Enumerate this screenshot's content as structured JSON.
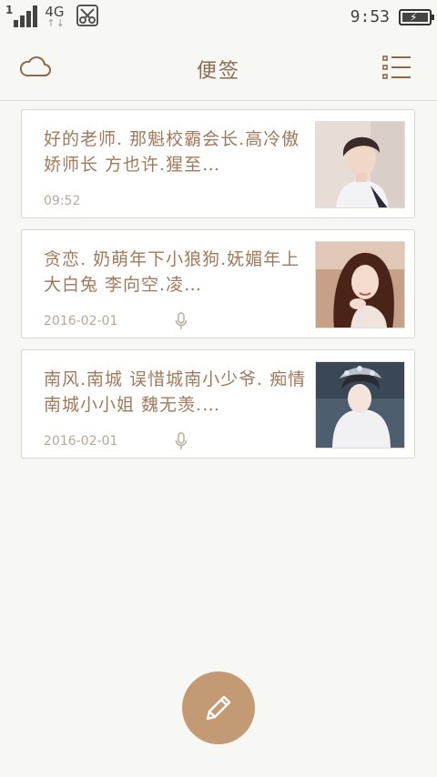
{
  "status_bar": {
    "signal_level": "1",
    "network": "4G",
    "network_arrows": "↑↓",
    "time": "9:53",
    "icons": [
      "signal-icon",
      "network-4g-icon",
      "no-sim-icon",
      "battery-charging-icon"
    ]
  },
  "app_bar": {
    "title": "便签",
    "left_icon": "cloud-icon",
    "right_icon": "list-view-icon"
  },
  "notes": [
    {
      "text": "好的老师. 那魁校霸会长.高冷傲娇师长 方也许.猩至…",
      "date": "09:52",
      "has_audio": false,
      "thumb_icon": "photo-portrait-man-icon"
    },
    {
      "text": "贪恋. 奶萌年下小狼狗.妩媚年上大白兔 李向空.凌…",
      "date": "2016-02-01",
      "has_audio": true,
      "thumb_icon": "photo-portrait-woman-icon"
    },
    {
      "text": "南风.南城 误惜城南小少爷. 痴情南城小小姐 魏无羡.…",
      "date": "2016-02-01",
      "has_audio": true,
      "thumb_icon": "photo-portrait-costume-icon"
    }
  ],
  "fab": {
    "icon": "pencil-icon"
  },
  "colors": {
    "accent": "#c49a74",
    "text": "#a07a5a",
    "background": "#f7f7f3"
  }
}
